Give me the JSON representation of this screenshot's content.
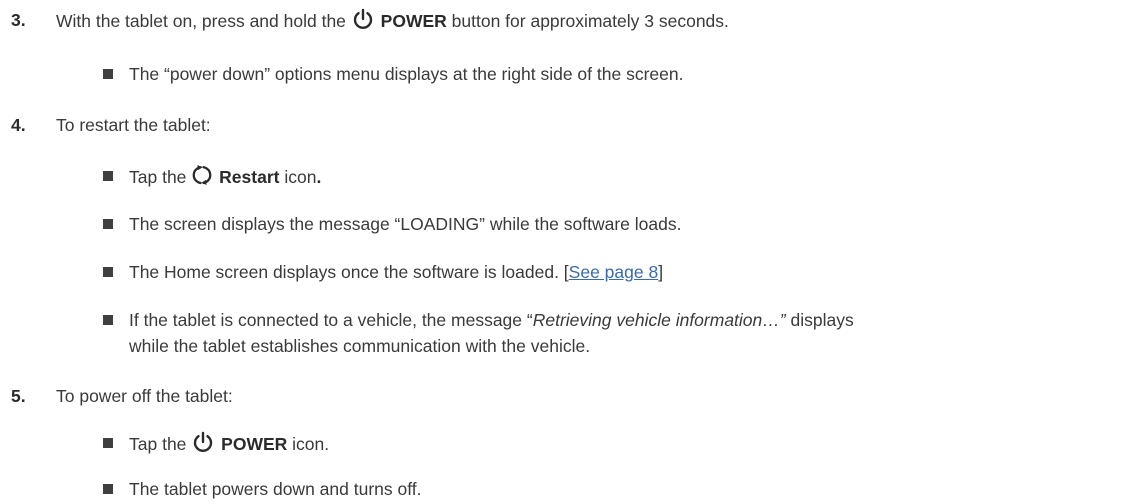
{
  "step3": {
    "number": "3.",
    "text_before": "With the tablet on, press and hold the",
    "bold": "POWER",
    "text_after": "button for approximately 3 seconds.",
    "icon": "power-icon",
    "bullet1": "The “power down” options menu displays at the right side of the screen."
  },
  "step4": {
    "number": "4.",
    "text": "To restart the tablet:",
    "bullets": {
      "b1": {
        "before": "Tap the",
        "bold": "Restart",
        "after": "icon",
        "period": ".",
        "icon": "restart-icon"
      },
      "b2": "The screen displays the message “LOADING” while the software loads.",
      "b3": {
        "before": "The Home screen displays once the software is loaded. [",
        "link": "See page 8",
        "after": "]"
      },
      "b4": {
        "before": "If the tablet is connected to a vehicle, the message “",
        "italic": "Retrieving vehicle information…”",
        "after": " displays",
        "line2": "while the tablet establishes communication with the vehicle."
      }
    }
  },
  "step5": {
    "number": "5.",
    "text": "To power off the tablet:",
    "bullets": {
      "b1": {
        "before": "Tap the",
        "bold": "POWER",
        "after": "icon.",
        "icon": "power-icon"
      },
      "b2": "The tablet powers down and turns off."
    }
  },
  "colors": {
    "text": "#3a3a3a",
    "link": "#3b6aa8",
    "bullet": "#3f3f3f"
  }
}
